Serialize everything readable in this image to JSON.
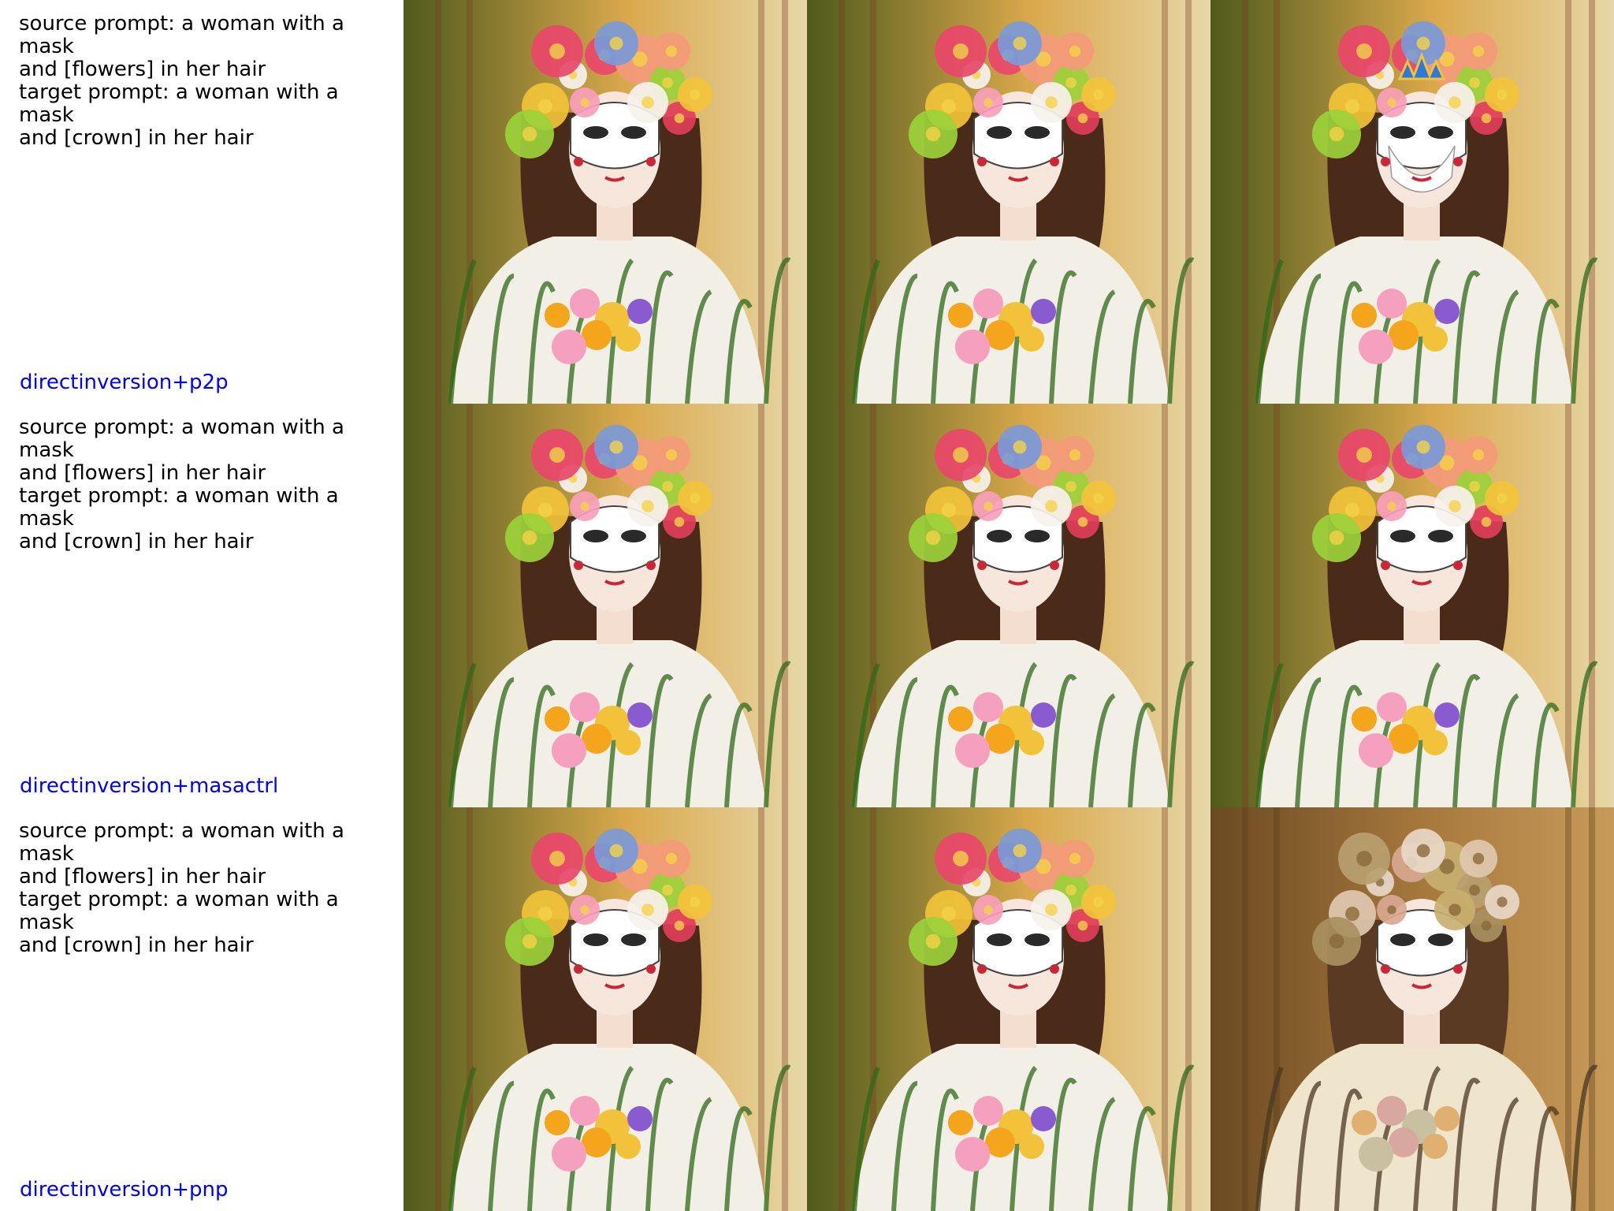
{
  "rows": [
    {
      "source_prompt_line": "source prompt: a woman with a mask\nand [flowers] in her hair",
      "target_prompt_line": "target prompt: a woman with a mask\nand [crown] in her hair",
      "method": "directinversion+p2p"
    },
    {
      "source_prompt_line": "source prompt: a woman with a mask\nand [flowers] in her hair",
      "target_prompt_line": "target prompt: a woman with a mask\nand [crown] in her hair",
      "method": "directinversion+masactrl"
    },
    {
      "source_prompt_line": "source prompt: a woman with a mask\nand [flowers] in her hair",
      "target_prompt_line": "target prompt: a woman with a mask\nand [crown] in her hair",
      "method": "directinversion+pnp"
    }
  ],
  "colors": {
    "method_label": "#0000ff",
    "prompt_text": "#000000",
    "background": "#ffffff"
  }
}
